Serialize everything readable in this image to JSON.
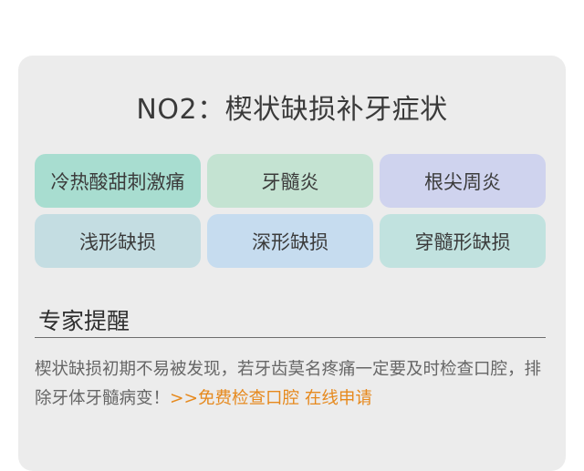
{
  "title": "NO2：楔状缺损补牙症状",
  "symptoms": [
    {
      "label": "冷热酸甜刺激痛"
    },
    {
      "label": "牙髓炎"
    },
    {
      "label": "根尖周炎"
    },
    {
      "label": "浅形缺损"
    },
    {
      "label": "深形缺损"
    },
    {
      "label": "穿髓形缺损"
    }
  ],
  "tips": {
    "heading": "专家提醒",
    "text": "楔状缺损初期不易被发现，若牙齿莫名疼痛一定要及时检查口腔，排除牙体牙髓病变！",
    "cta": ">>免费检查口腔 在线申请"
  },
  "colors": {
    "cta": "#e6891d",
    "symptom_backgrounds": [
      "#a8ddd0",
      "#c4e3d2",
      "#cfd3ee",
      "#c4dde2",
      "#c6dcef",
      "#c1e2df"
    ]
  }
}
